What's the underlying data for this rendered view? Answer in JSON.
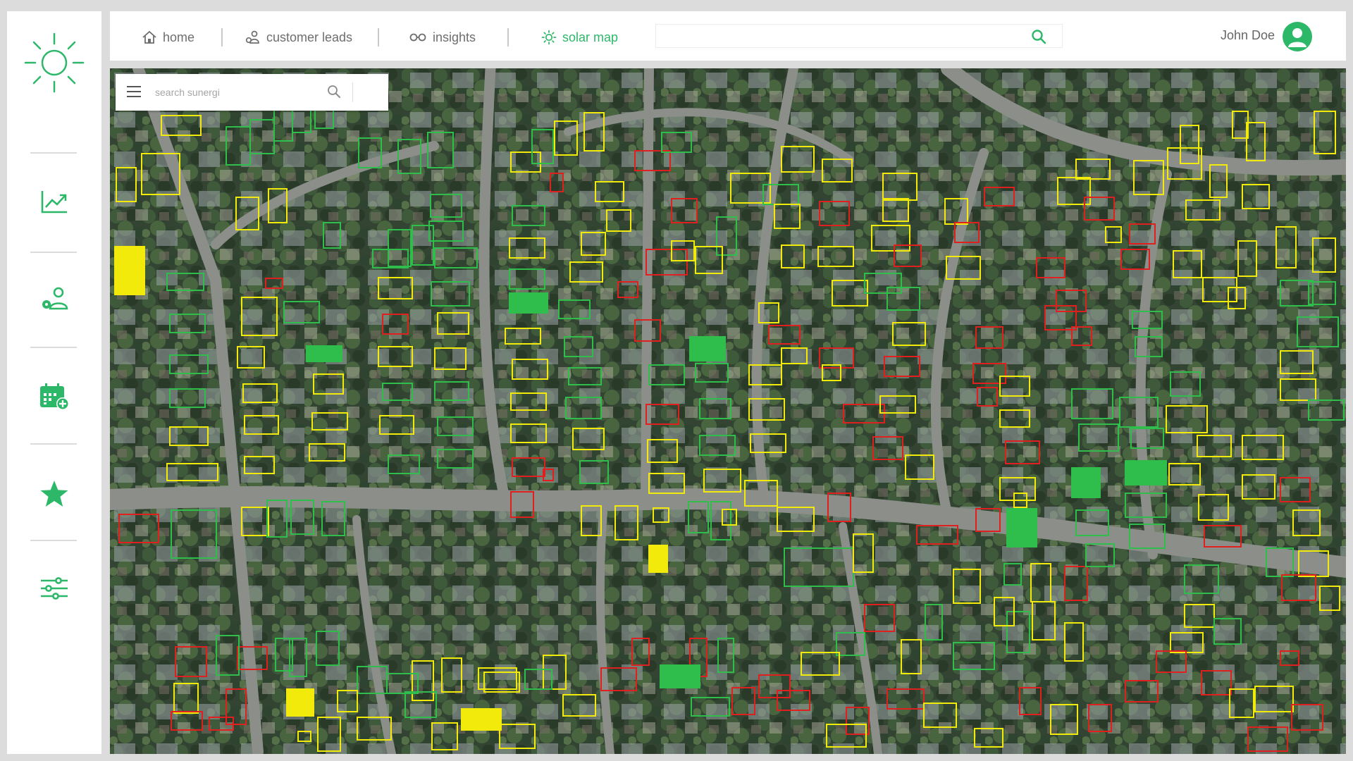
{
  "brand": {
    "logo_icon": "sun-icon",
    "accent_color": "#2db869"
  },
  "sidebar": {
    "items": [
      {
        "name": "analytics",
        "icon": "trend-chart-icon"
      },
      {
        "name": "leads",
        "icon": "user-location-icon"
      },
      {
        "name": "schedule",
        "icon": "calendar-add-icon"
      },
      {
        "name": "favorites",
        "icon": "star-icon"
      },
      {
        "name": "settings",
        "icon": "sliders-icon"
      }
    ]
  },
  "topbar": {
    "tabs": [
      {
        "label": "home",
        "icon": "home-icon",
        "active": false
      },
      {
        "label": "customer leads",
        "icon": "users-icon",
        "active": false
      },
      {
        "label": "insights",
        "icon": "glasses-icon",
        "active": false
      },
      {
        "label": "solar map",
        "icon": "sun-icon",
        "active": true
      }
    ],
    "search": {
      "value": "",
      "placeholder": "",
      "icon": "search-icon"
    },
    "user": {
      "name": "John Doe",
      "icon": "user-avatar-icon"
    }
  },
  "map": {
    "search": {
      "placeholder": "search sunergi",
      "value": "",
      "icon": "search-icon",
      "menu_icon": "menu-icon"
    },
    "legend_colors": {
      "high": "#2fbe4b",
      "medium": "#f2ea0a",
      "low": "#e0201e"
    }
  }
}
